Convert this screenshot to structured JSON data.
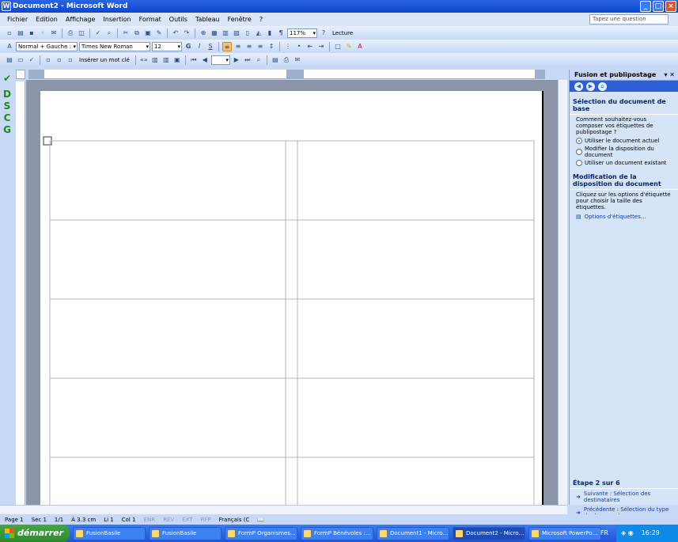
{
  "window": {
    "title": "Document2 - Microsoft Word",
    "minimize": "_",
    "maximize": "□",
    "close": "×"
  },
  "menu": [
    "Fichier",
    "Edition",
    "Affichage",
    "Insertion",
    "Format",
    "Outils",
    "Tableau",
    "Fenêtre",
    "?"
  ],
  "help": {
    "placeholder": "Tapez une question"
  },
  "toolbar1": {
    "zoom": "117%",
    "read": "Lecture"
  },
  "toolbar2": {
    "style": "Normal + Gauche :",
    "font": "Times New Roman",
    "size": "12",
    "bold": "G",
    "italic": "I",
    "underline": "S"
  },
  "toolbar3": {
    "insert_field": "Insérer un mot clé"
  },
  "leftbar": [
    "D",
    "S",
    "C",
    "G"
  ],
  "task_pane": {
    "title": "Fusion et publipostage",
    "section1": "Sélection du document de base",
    "question": "Comment souhaitez-vous composer vos étiquettes de publipostage ?",
    "options": [
      "Utiliser le document actuel",
      "Modifier la disposition du document",
      "Utiliser un document existant"
    ],
    "selected_option": 0,
    "section2": "Modification de la disposition du document",
    "desc2": "Cliquez sur les options d'étiquette pour choisir la taille des étiquettes.",
    "link_options": "Options d'étiquettes…",
    "step": "Étape 2 sur 6",
    "next": "Suivante : Sélection des destinataires",
    "prev": "Précédente : Sélection du type de document"
  },
  "status": {
    "page": "Page 1",
    "section": "Sec 1",
    "pages": "1/1",
    "at": "À 3.3 cm",
    "line": "Li 1",
    "col": "Col 1",
    "enr": "ENR",
    "rev": "REV",
    "ext": "EXT",
    "rfp": "RFP",
    "lang": "Français (C"
  },
  "taskbar": {
    "start": "démarrer",
    "items": [
      "FusionBasile",
      "FusionBasile",
      "FormP Organismes…",
      "FormP Bénévoles :…",
      "Document1 - Micro…",
      "Document2 - Micro…",
      "Microsoft PowerPo…"
    ],
    "active": 5,
    "lang": "FR",
    "time": "16:29"
  },
  "colors": {
    "titlebar": "#0e46d0",
    "taskpane": "#d6e4f8",
    "start": "#2c8a2c"
  }
}
